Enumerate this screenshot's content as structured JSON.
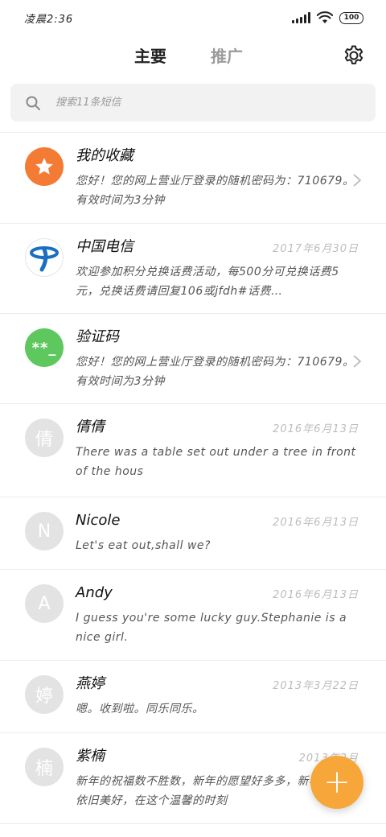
{
  "status_bar": {
    "time": "凌晨2:36",
    "battery": "100"
  },
  "header": {
    "tab_primary": "主要",
    "tab_promo": "推广"
  },
  "search": {
    "placeholder": "搜索11条短信"
  },
  "conversations": [
    {
      "name": "我的收藏",
      "date": "",
      "preview": "您好！您的网上营业厅登录的随机密码为：710679。有效时间为3分钟",
      "avatar_icon": "star-icon",
      "avatar_color": "#f47b34",
      "avatar_letter": "",
      "has_chevron": true
    },
    {
      "name": "中国电信",
      "date": "2017年6月30日",
      "preview": "欢迎参加积分兑换话费活动，每500分可兑换话费5元，兑换话费请回复106或jfdh#话费…",
      "avatar_icon": "china-telecom-logo-icon",
      "avatar_color": "#1a6fc0",
      "avatar_letter": "",
      "has_chevron": false
    },
    {
      "name": "验证码",
      "date": "",
      "preview": "您好！您的网上营业厅登录的随机密码为：710679。有效时间为3分钟",
      "avatar_icon": "verification-code-icon",
      "avatar_color": "#5ec85e",
      "avatar_letter": "**_",
      "has_chevron": true
    },
    {
      "name": "倩倩",
      "date": "2016年6月13日",
      "preview": "There was a table set out under a tree in front of the hous",
      "avatar_icon": "letter-avatar",
      "avatar_color": "#e3e3e3",
      "avatar_letter": "倩",
      "has_chevron": false
    },
    {
      "name": "Nicole",
      "date": "2016年6月13日",
      "preview": "Let's eat out,shall we?",
      "avatar_icon": "letter-avatar",
      "avatar_color": "#e3e3e3",
      "avatar_letter": "N",
      "has_chevron": false
    },
    {
      "name": "Andy",
      "date": "2016年6月13日",
      "preview": "I guess you're some lucky guy.Stephanie is a nice girl.",
      "avatar_icon": "letter-avatar",
      "avatar_color": "#e3e3e3",
      "avatar_letter": "A",
      "has_chevron": false
    },
    {
      "name": "燕婷",
      "date": "2013年3月22日",
      "preview": "嗯。收到啦。同乐同乐。",
      "avatar_icon": "letter-avatar",
      "avatar_color": "#e3e3e3",
      "avatar_letter": "婷",
      "has_chevron": false
    },
    {
      "name": "紫楠",
      "date": "2013年2月",
      "preview": "新年的祝福数不胜数，新年的愿望好多多，新年的问候依旧美好，在这个温馨的时刻",
      "avatar_icon": "letter-avatar",
      "avatar_color": "#e3e3e3",
      "avatar_letter": "楠",
      "has_chevron": false
    }
  ],
  "fab": {
    "label": "+"
  },
  "colors": {
    "accent": "#f7a63a",
    "divider": "#ececec",
    "muted_text": "#bdbdbd"
  }
}
